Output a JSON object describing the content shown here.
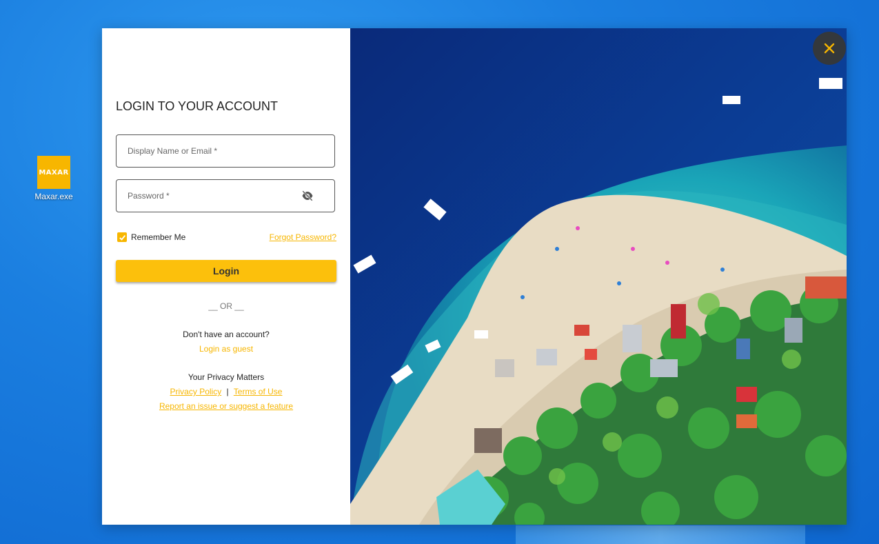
{
  "desktop": {
    "icon_label": "Maxar.exe",
    "logo_text": "MAXAR"
  },
  "login": {
    "title": "LOGIN TO YOUR ACCOUNT",
    "username_placeholder": "Display Name or Email *",
    "password_placeholder": "Password *",
    "remember_label": "Remember Me",
    "remember_checked": true,
    "forgot_label": "Forgot Password?",
    "login_button": "Login",
    "or_separator": "__ OR __",
    "no_account_text": "Don't have an account?",
    "guest_link": "Login as guest",
    "privacy_heading": "Your Privacy Matters",
    "privacy_link": "Privacy Policy",
    "separator": "|",
    "terms_link": "Terms of Use",
    "report_link": "Report an issue or suggest a feature"
  },
  "icons": {
    "password_toggle": "eye-off-icon",
    "close": "close-icon",
    "checkbox": "check-icon"
  },
  "colors": {
    "accent": "#fcc00c",
    "link": "#f7b600",
    "desktop_bg": "#1b7fe0"
  }
}
